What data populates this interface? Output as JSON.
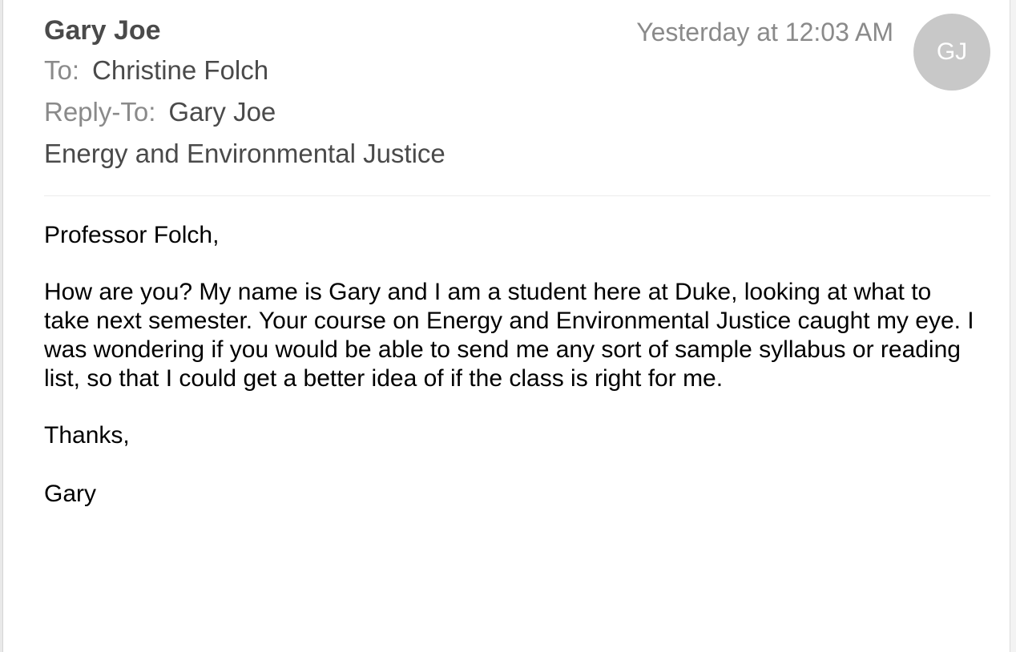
{
  "email": {
    "sender": "Gary Joe",
    "timestamp": "Yesterday at 12:03 AM",
    "avatar_initials": "GJ",
    "to_label": "To:",
    "to_value": "Christine Folch",
    "reply_to_label": "Reply-To:",
    "reply_to_value": "Gary Joe",
    "subject": "Energy and Environmental Justice",
    "body": {
      "greeting": "Professor Folch,",
      "paragraph": "How are you? My name is Gary and I am a student here at Duke, looking at what to take next semester. Your course on Energy and Environmental Justice caught my eye. I was wondering if you would be able to send me any sort of sample syllabus or reading list, so that I could get a better idea of if the class is right for me.",
      "closing": "Thanks,",
      "signature": "Gary"
    }
  },
  "colors": {
    "header_text": "#4a4a4a",
    "label_text": "#8a8a8a",
    "avatar_bg": "#c8c8c8"
  }
}
